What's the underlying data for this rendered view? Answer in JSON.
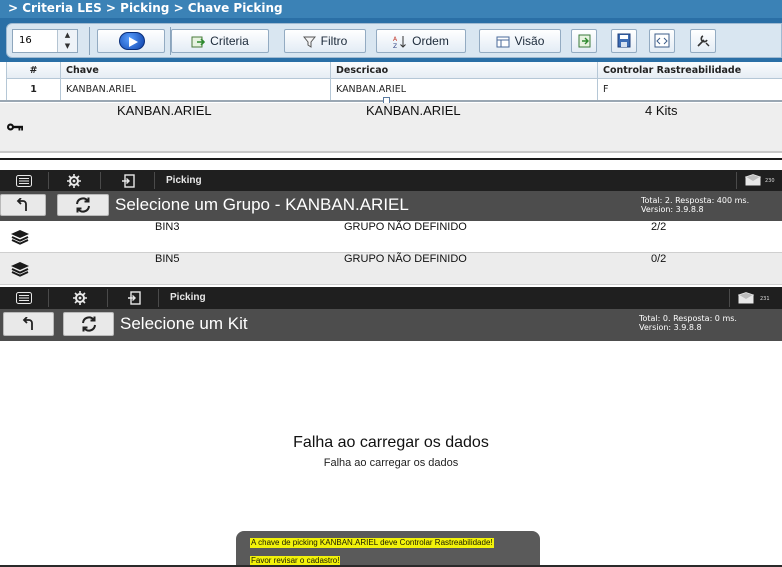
{
  "les": {
    "breadcrumb": "> Criteria LES > Picking > Chave Picking",
    "page_size_value": "16",
    "buttons": {
      "criteria": "Criteria",
      "filtro": "Filtro",
      "ordem": "Ordem",
      "visao": "Visão"
    },
    "grid": {
      "headers": [
        "#",
        "Chave",
        "Descricao",
        "Controlar Rastreabilidade"
      ],
      "rows": [
        [
          "1",
          "KANBAN.ARIEL",
          "KANBAN.ARIEL",
          "F"
        ]
      ]
    }
  },
  "key_row": {
    "icon": "key-icon",
    "chave": "KANBAN.ARIEL",
    "descricao": "KANBAN.ARIEL",
    "kits": "4 Kits"
  },
  "grupo_screen": {
    "topbar_title": "Picking",
    "mail_count": "230",
    "title": "Selecione um Grupo - KANBAN.ARIEL",
    "info_line1": "Total: 2. Resposta: 400 ms.",
    "info_line2": "Version: 3.9.8.8",
    "items": [
      {
        "icon": "layers-icon",
        "name": "BIN3",
        "group": "GRUPO NÃO DEFINIDO",
        "count": "2/2"
      },
      {
        "icon": "layers-icon",
        "name": "BIN5",
        "group": "GRUPO NÃO DEFINIDO",
        "count": "0/2"
      }
    ]
  },
  "kit_screen": {
    "topbar_title": "Picking",
    "mail_count": "231",
    "title": "Selecione um Kit",
    "info_line1": "Total: 0. Resposta: 0 ms.",
    "info_line2": "Version: 3.9.8.8",
    "error_main": "Falha ao carregar os dados",
    "error_sub": "Falha ao carregar os dados",
    "toast_line1": "A chave de picking KANBAN.ARIEL deve Controlar Rastreabilidade!",
    "toast_line2": "Favor revisar o cadastro!"
  },
  "colors": {
    "les_blue": "#2a6fa6",
    "mobile_header": "#4d4d4d",
    "mobile_topbar": "#1f1f1f",
    "toast_highlight": "#f2f20a"
  }
}
